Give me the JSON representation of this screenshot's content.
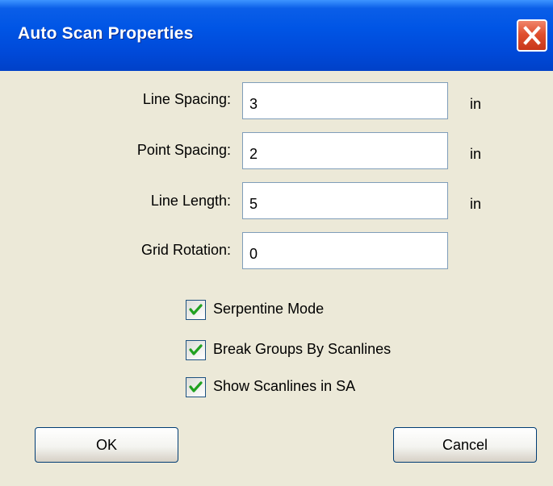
{
  "window": {
    "title": "Auto Scan Properties"
  },
  "icons": {
    "close": "close-x-icon",
    "check": "checkmark-icon"
  },
  "colors": {
    "titlebar": "#0055e5",
    "close_button": "#e0502f",
    "dialog_background": "#ece9d8",
    "check_mark": "#21a121"
  },
  "fields": {
    "line_spacing": {
      "label": "Line Spacing:",
      "value": "3",
      "unit": "in"
    },
    "point_spacing": {
      "label": "Point Spacing:",
      "value": "2",
      "unit": "in"
    },
    "line_length": {
      "label": "Line Length:",
      "value": "5",
      "unit": "in"
    },
    "grid_rotation": {
      "label": "Grid Rotation:",
      "value": "0"
    }
  },
  "options": {
    "serpentine_mode": {
      "label": "Serpentine Mode",
      "checked": true
    },
    "break_groups": {
      "label": "Break Groups By Scanlines",
      "checked": true
    },
    "show_scanlines": {
      "label": "Show Scanlines in SA",
      "checked": true
    }
  },
  "buttons": {
    "ok": "OK",
    "cancel": "Cancel"
  }
}
